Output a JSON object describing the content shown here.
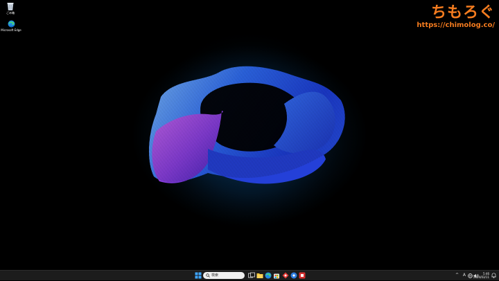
{
  "desktop": {
    "icons": [
      {
        "label": "ごみ箱",
        "icon": "recycle-bin-icon"
      },
      {
        "label": "Microsoft Edge",
        "icon": "edge-icon"
      }
    ],
    "wallpaper": "windows-11-bloom-wallpaper"
  },
  "watermark": {
    "brand": "ちもろぐ",
    "url": "https://chimolog.co/",
    "color": "#f57c1f"
  },
  "taskbar": {
    "search_placeholder": "検索",
    "pinned": [
      {
        "name": "start-icon"
      },
      {
        "name": "task-view-icon"
      },
      {
        "name": "file-explorer-icon"
      },
      {
        "name": "edge-icon"
      },
      {
        "name": "microsoft-store-icon"
      },
      {
        "name": "app-red-icon"
      },
      {
        "name": "app-blue-icon"
      },
      {
        "name": "app-red-square-icon"
      }
    ],
    "tray": {
      "chevron": "^",
      "ime": "A",
      "time": "5:46",
      "date": "2024/03/11"
    }
  }
}
